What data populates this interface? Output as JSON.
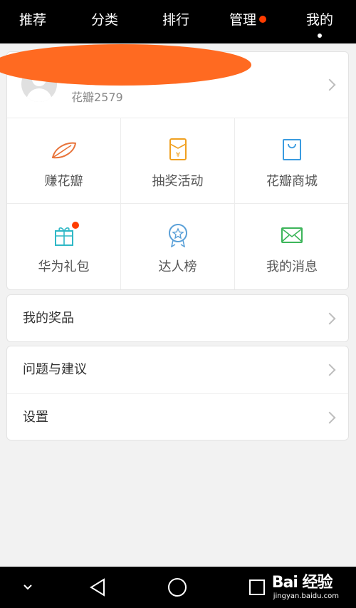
{
  "top_nav": {
    "tabs": [
      {
        "label": "推荐"
      },
      {
        "label": "分类"
      },
      {
        "label": "排行"
      },
      {
        "label": "管理",
        "has_notification_dot": true
      },
      {
        "label": "我的",
        "active": true
      }
    ]
  },
  "profile": {
    "username": "花瓣2579"
  },
  "feature_grid": [
    {
      "label": "赚花瓣",
      "icon": "petal-icon",
      "color": "#e8743b"
    },
    {
      "label": "抽奖活动",
      "icon": "red-envelope-icon",
      "color": "#f0a020"
    },
    {
      "label": "花瓣商城",
      "icon": "shopping-bag-icon",
      "color": "#3a9be0"
    },
    {
      "label": "华为礼包",
      "icon": "gift-icon",
      "color": "#2fb8c6",
      "has_badge": true
    },
    {
      "label": "达人榜",
      "icon": "award-ribbon-icon",
      "color": "#5aa0d8"
    },
    {
      "label": "我的消息",
      "icon": "envelope-icon",
      "color": "#3db55a"
    }
  ],
  "menu": {
    "prizes": "我的奖品",
    "feedback": "问题与建议",
    "settings": "设置"
  },
  "watermark": {
    "brand": "Bai 经验",
    "url": "jingyan.baidu.com"
  },
  "colors": {
    "accent_orange": "#ff6a21",
    "notification_red": "#ff3c00"
  }
}
